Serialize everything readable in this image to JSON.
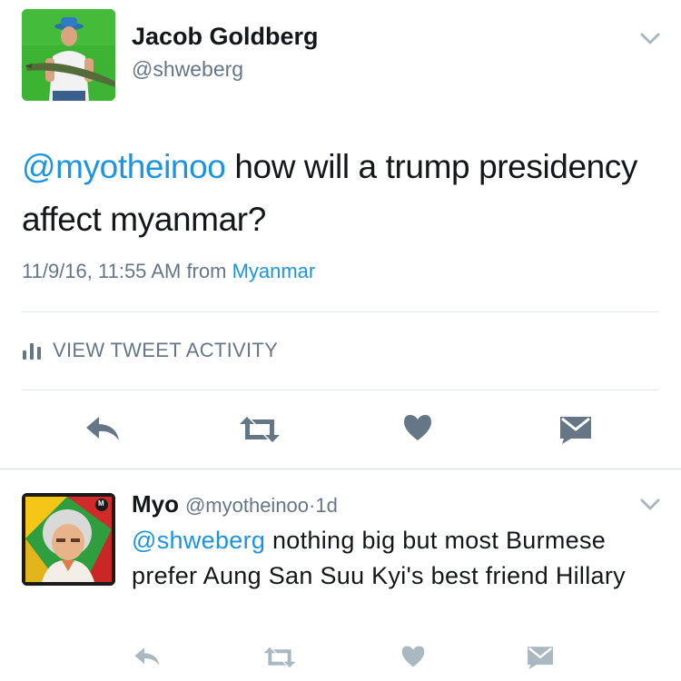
{
  "main_tweet": {
    "author_name": "Jacob Goldberg",
    "author_handle": "@shweberg",
    "mention": "@myotheinoo",
    "text": " how will a trump presidency affect myanmar?",
    "timestamp": "11/9/16, 11:55 AM",
    "from_label": "from",
    "location": "Myanmar",
    "activity_label": "VIEW TWEET ACTIVITY",
    "icons": [
      "reply-icon",
      "retweet-icon",
      "like-icon",
      "message-icon",
      "chevron-down-icon",
      "bar-chart-icon"
    ]
  },
  "reply": {
    "author_name": "Myo",
    "author_handle": "@myotheinoo",
    "separator": "·",
    "time": "1d",
    "mention": "@shweberg",
    "text": " nothing big but most Burmese prefer Aung San Suu Kyi's best friend Hillary",
    "badge": "M"
  },
  "colors": {
    "accent": "#1b95e0",
    "secondary_text": "#657786",
    "icon_gray": "#657786",
    "reply_icon_gray": "#aab8c2",
    "divider": "#e1e8ed"
  }
}
